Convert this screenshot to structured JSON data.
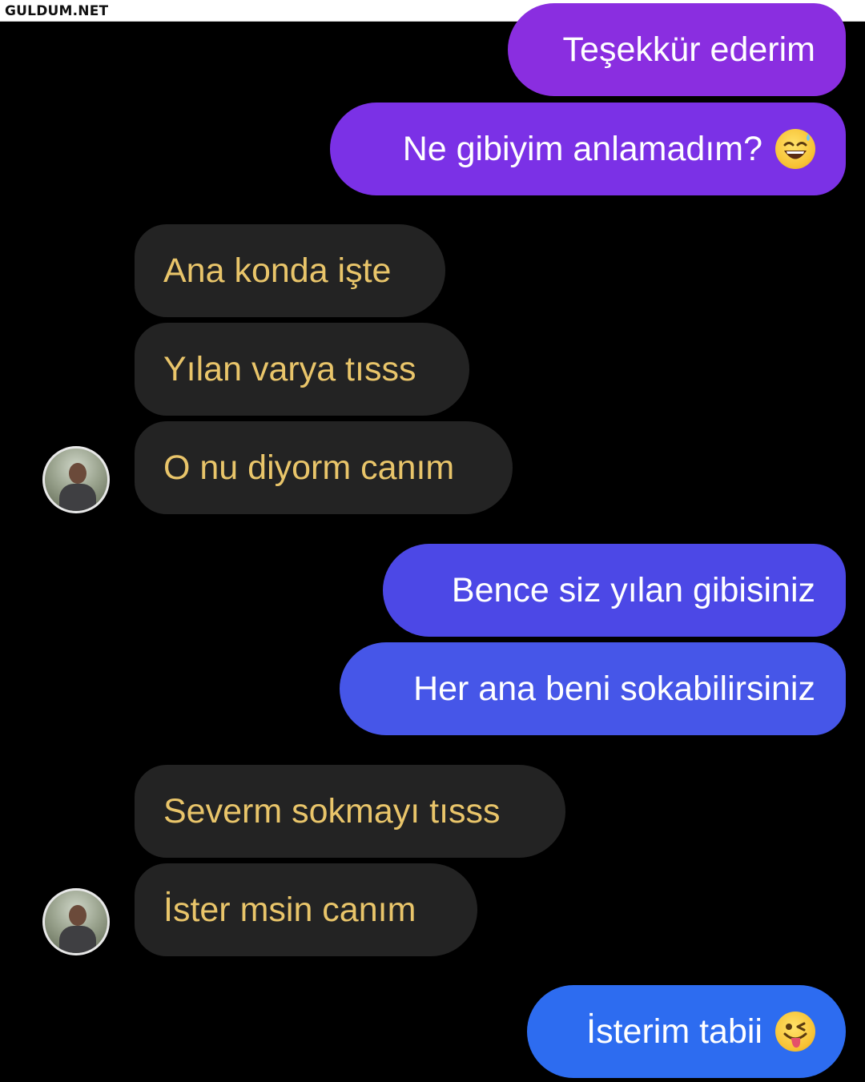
{
  "watermark": "GULDUM.NET",
  "colors": {
    "background": "#000000",
    "incoming_bubble": "#232323",
    "incoming_text": "#e9c56a",
    "outgoing_text": "#ffffff"
  },
  "messages": [
    {
      "direction": "outgoing",
      "text": "Teşekkür ederim",
      "color": "#8a2ee0"
    },
    {
      "direction": "outgoing",
      "text": "Ne gibiyim anlamadım?",
      "emoji": "grinning-sweat-emoji",
      "color": "#7b31e6"
    },
    {
      "direction": "incoming",
      "text": "Ana konda işte"
    },
    {
      "direction": "incoming",
      "text": "Yılan varya tısss"
    },
    {
      "direction": "incoming",
      "text": "O nu diyorm canım",
      "avatar": true
    },
    {
      "direction": "outgoing",
      "text": "Bence siz yılan gibisiniz",
      "color": "#4c48e6"
    },
    {
      "direction": "outgoing",
      "text": "Her ana beni sokabilirsiniz",
      "color": "#4656e8"
    },
    {
      "direction": "incoming",
      "text": "Severm sokmayı tısss"
    },
    {
      "direction": "incoming",
      "text": "İster msin canım",
      "avatar": true
    },
    {
      "direction": "outgoing",
      "text": "İsterim tabii",
      "emoji": "winking-tongue-emoji",
      "color": "#2d6cf0"
    }
  ]
}
